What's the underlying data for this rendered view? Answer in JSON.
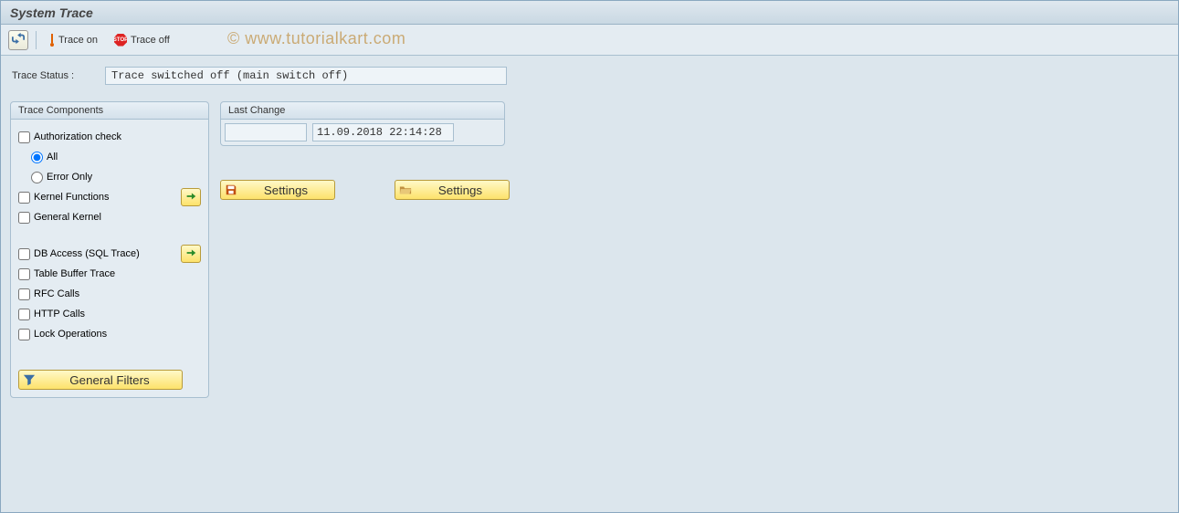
{
  "title": "System Trace",
  "watermark": "© www.tutorialkart.com",
  "toolbar": {
    "trace_on_label": "Trace on",
    "trace_off_label": "Trace off"
  },
  "status": {
    "label": "Trace Status :",
    "value": "Trace switched off (main switch off)"
  },
  "trace_components": {
    "title": "Trace Components",
    "auth_check": "Authorization check",
    "radio_all": "All",
    "radio_error_only": "Error Only",
    "kernel_functions": "Kernel Functions",
    "general_kernel": "General Kernel",
    "db_access": "DB Access (SQL Trace)",
    "table_buffer": "Table Buffer Trace",
    "rfc_calls": "RFC Calls",
    "http_calls": "HTTP Calls",
    "lock_operations": "Lock Operations",
    "general_filters_btn": "General Filters"
  },
  "last_change": {
    "title": "Last Change",
    "user": "",
    "datetime": "11.09.2018 22:14:28"
  },
  "settings": {
    "save_label": "Settings",
    "open_label": "Settings"
  },
  "colors": {
    "panel_border": "#a8bfd0",
    "bg": "#dce6ed",
    "button_yellow_top": "#fff9c8",
    "button_yellow_bottom": "#fde26b"
  }
}
